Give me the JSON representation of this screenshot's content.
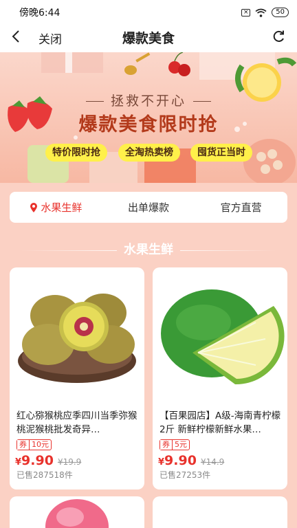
{
  "status": {
    "time": "傍晚6:44",
    "battery": "50"
  },
  "nav": {
    "close_label": "关闭",
    "title": "爆款美食"
  },
  "banner": {
    "subtitle": "拯救不开心",
    "title": "爆款美食限时抢",
    "tags": [
      "特价限时抢",
      "全淘热卖榜",
      "囤货正当时"
    ]
  },
  "tabs": [
    {
      "label": "水果生鲜",
      "active": true
    },
    {
      "label": "出单爆款",
      "active": false
    },
    {
      "label": "官方直营",
      "active": false
    }
  ],
  "section": {
    "title": "水果生鲜"
  },
  "products": [
    {
      "name": "红心猕猴桃应季四川当季弥猴桃泥猴桃批发奇异…",
      "coupon_label": "券",
      "coupon_value": "10元",
      "currency": "¥",
      "price": "9.90",
      "original_price": "¥19.9",
      "sold": "已售287518件"
    },
    {
      "name": "【百果园店】A级-海南青柠檬2斤 新鲜柠檬新鲜水果…",
      "coupon_label": "券",
      "coupon_value": "5元",
      "currency": "¥",
      "price": "9.90",
      "original_price": "¥14.9",
      "sold": "已售27253件"
    }
  ]
}
